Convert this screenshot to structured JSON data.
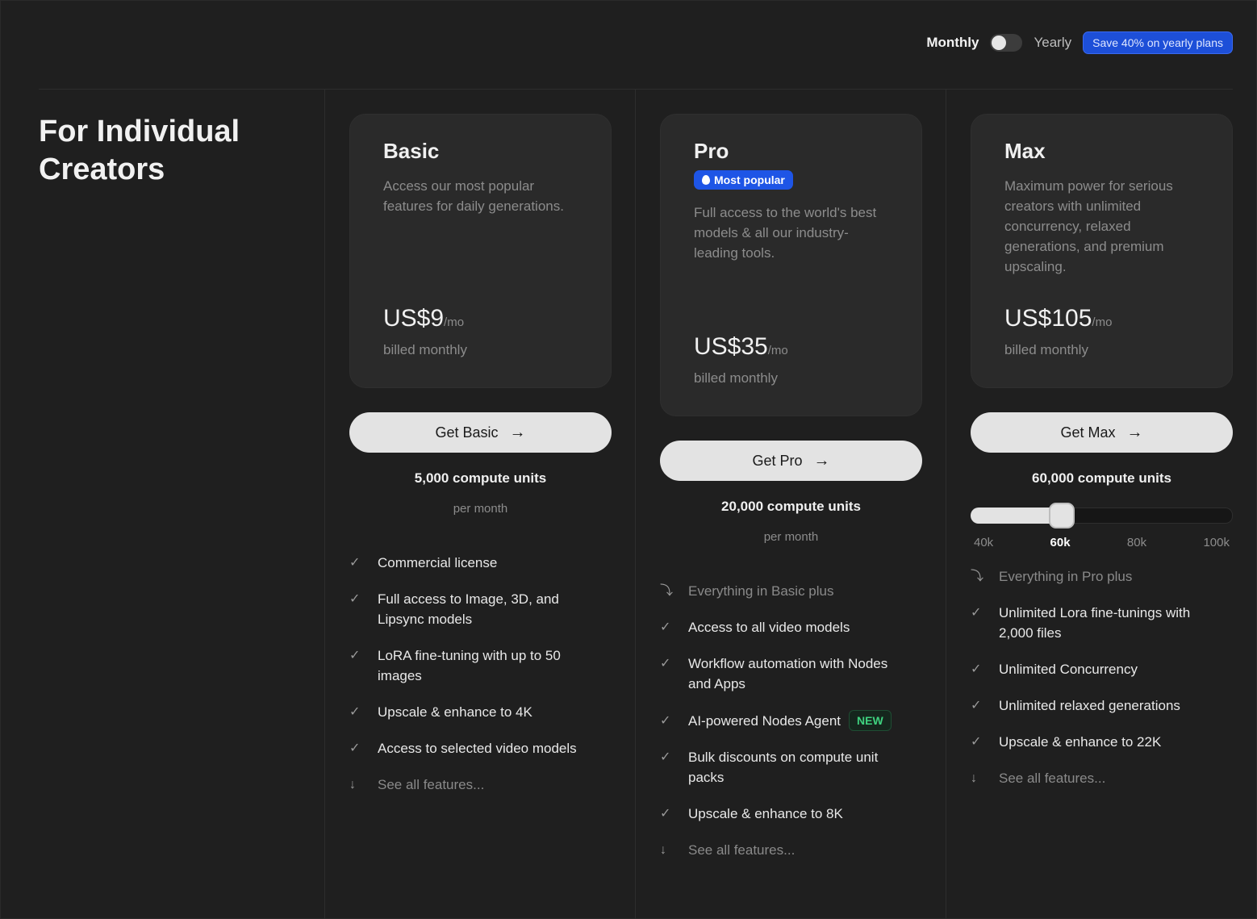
{
  "billing": {
    "monthly_label": "Monthly",
    "yearly_label": "Yearly",
    "toggle_state": "monthly",
    "save_badge": "Save 40% on yearly plans"
  },
  "heading": "For Individual Creators",
  "plans": [
    {
      "name": "Basic",
      "description": "Access our most popular features for daily generations.",
      "price": "US$9",
      "per": "/mo",
      "billed": "billed monthly",
      "cta": "Get Basic",
      "units": "5,000 compute units",
      "per_month": "per month",
      "features": [
        {
          "icon": "check-icon",
          "text": "Commercial license"
        },
        {
          "icon": "check-icon",
          "text": "Full access to Image, 3D, and Lipsync models"
        },
        {
          "icon": "check-icon",
          "text": "LoRA fine-tuning with up to 50 images"
        },
        {
          "icon": "check-icon",
          "text": "Upscale & enhance to 4K"
        },
        {
          "icon": "check-icon",
          "text": "Access to selected video models"
        },
        {
          "icon": "arrow-down-icon",
          "text": "See all features..."
        }
      ]
    },
    {
      "name": "Pro",
      "badge": "Most popular",
      "description": "Full access to the world's best models & all our industry-leading tools.",
      "price": "US$35",
      "per": "/mo",
      "billed": "billed monthly",
      "cta": "Get Pro",
      "units": "20,000 compute units",
      "per_month": "per month",
      "features": [
        {
          "icon": "return-arrow-icon",
          "text": "Everything in Basic plus"
        },
        {
          "icon": "check-icon",
          "text": "Access to all video models"
        },
        {
          "icon": "check-icon",
          "text": "Workflow automation with Nodes and Apps"
        },
        {
          "icon": "check-icon",
          "text": "AI-powered Nodes Agent",
          "badge": "NEW"
        },
        {
          "icon": "check-icon",
          "text": "Bulk discounts on compute unit packs"
        },
        {
          "icon": "check-icon",
          "text": "Upscale & enhance to 8K"
        },
        {
          "icon": "arrow-down-icon",
          "text": "See all features..."
        }
      ]
    },
    {
      "name": "Max",
      "description": "Maximum power for serious creators with unlimited concurrency, relaxed generations, and premium upscaling.",
      "price": "US$105",
      "per": "/mo",
      "billed": "billed monthly",
      "cta": "Get Max",
      "units": "60,000 compute units",
      "slider": {
        "ticks": [
          "40k",
          "60k",
          "80k",
          "100k"
        ],
        "selected": "60k"
      },
      "features": [
        {
          "icon": "return-arrow-icon",
          "text": "Everything in Pro plus"
        },
        {
          "icon": "check-icon",
          "text": "Unlimited Lora fine-tunings with 2,000 files"
        },
        {
          "icon": "check-icon",
          "text": "Unlimited Concurrency"
        },
        {
          "icon": "check-icon",
          "text": "Unlimited relaxed generations"
        },
        {
          "icon": "check-icon",
          "text": "Upscale & enhance to 22K"
        },
        {
          "icon": "arrow-down-icon",
          "text": "See all features..."
        }
      ]
    }
  ],
  "colors": {
    "background": "#1f1f1f",
    "card": "#2a2a2a",
    "accent_blue": "#1e55e6",
    "new_green": "#3fd27f"
  }
}
